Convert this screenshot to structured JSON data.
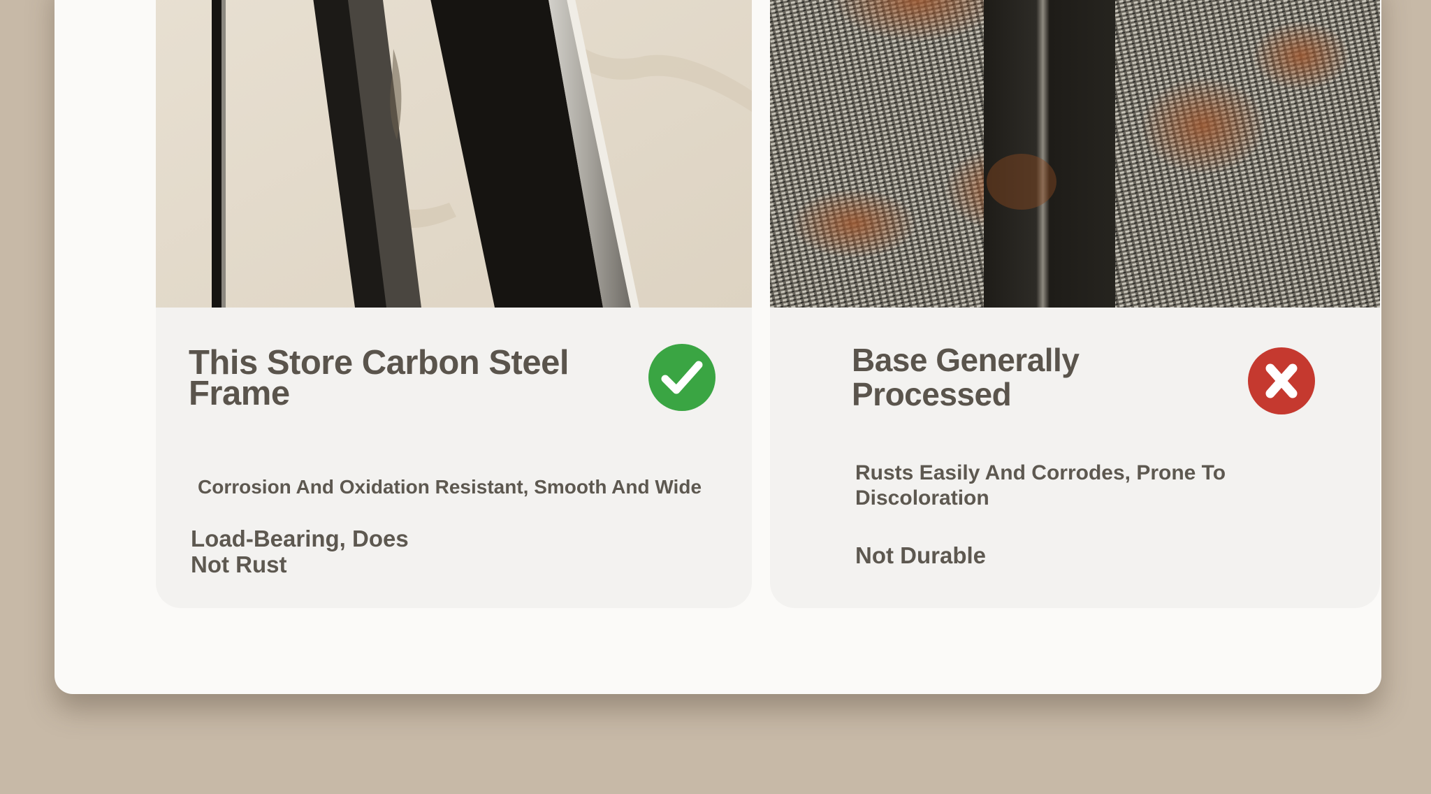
{
  "comparison": {
    "ours": {
      "title": "This Store Carbon Steel Frame",
      "features": [
        "Corrosion And Oxidation Resistant, Smooth And Wide",
        "Load-Bearing, Does Not Rust"
      ],
      "badge_icon": "check-icon",
      "badge_color": "#3aa543",
      "photo_background": "#e2d8c8",
      "photo_bar_color": "#161411"
    },
    "others": {
      "title": "Base Generally Processed",
      "features": [
        "Rusts Easily And Corrodes, Prone To Discoloration",
        "Not Durable"
      ],
      "badge_icon": "cross-icon",
      "badge_color": "#c5392f",
      "photo_background": "#6e675c",
      "rust_color": "#a8582a",
      "photo_bar_color": "#1e1c18"
    }
  }
}
